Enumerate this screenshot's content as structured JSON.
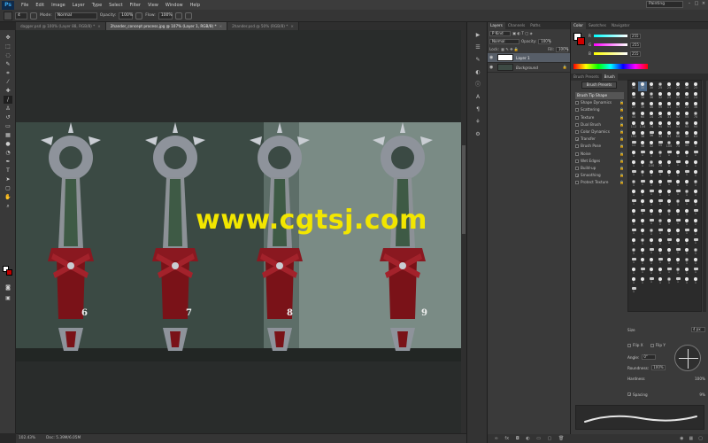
{
  "app": {
    "logo": "Ps",
    "menu": [
      "File",
      "Edit",
      "Image",
      "Layer",
      "Type",
      "Select",
      "Filter",
      "View",
      "Window",
      "Help"
    ],
    "workspace": "Painting",
    "min": "–",
    "max": "□",
    "close": "×"
  },
  "options": {
    "mode_label": "Mode:",
    "mode_value": "Normal",
    "opacity_label": "Opacity:",
    "opacity_value": "100%",
    "flow_label": "Flow:",
    "flow_value": "100%",
    "size_value": "4"
  },
  "tabs": [
    {
      "label": "dagger.psd @ 100% (Layer 88, RGB/8) *"
    },
    {
      "label": "2hander_concept process.jpg @ 107% (Layer 1, RGB/8) *"
    },
    {
      "label": "2hander.psd @ 50% (RGB/8) *"
    }
  ],
  "canvas": {
    "numbers": [
      "6",
      "7",
      "8",
      "9"
    ],
    "watermark": "www.cgtsj.com"
  },
  "status": {
    "zoom": "102.43%",
    "doc": "Doc: 5.39M/6.05M"
  },
  "layers_panel": {
    "tabs": [
      "Layers",
      "Channels",
      "Paths"
    ],
    "kind_label": "P Kind",
    "blend": "Normal",
    "opacity_label": "Opacity:",
    "opacity": "100%",
    "lock_label": "Lock:",
    "fill_label": "Fill:",
    "fill": "100%",
    "layers": [
      {
        "name": "Layer 1",
        "selected": true
      },
      {
        "name": "Background",
        "selected": false
      }
    ]
  },
  "color_panel": {
    "tabs": [
      "Color",
      "Swatches",
      "Navigator"
    ],
    "r_label": "R",
    "g_label": "G",
    "b_label": "B",
    "r": "255",
    "g": "255",
    "b": "255",
    "fg": "#ffffff",
    "bg": "#d00000"
  },
  "brush_panel": {
    "tabs": [
      "Brush Presets",
      "Brush"
    ],
    "presets_btn": "Brush Presets",
    "options": [
      {
        "label": "Brush Tip Shape",
        "head": true,
        "checked": false
      },
      {
        "label": "Shape Dynamics",
        "checked": false
      },
      {
        "label": "Scattering",
        "checked": false
      },
      {
        "label": "Texture",
        "checked": false
      },
      {
        "label": "Dual Brush",
        "checked": false
      },
      {
        "label": "Color Dynamics",
        "checked": false
      },
      {
        "label": "Transfer",
        "checked": true
      },
      {
        "label": "Brush Pose",
        "checked": false
      },
      {
        "label": "Noise",
        "checked": false
      },
      {
        "label": "Wet Edges",
        "checked": false
      },
      {
        "label": "Build-up",
        "checked": false
      },
      {
        "label": "Smoothing",
        "checked": true
      },
      {
        "label": "Protect Texture",
        "checked": false
      }
    ],
    "tip_numbers": [
      "30",
      "30",
      "30",
      "25",
      "25",
      "25",
      "36",
      "25",
      "36",
      "36",
      "36",
      "32",
      "25",
      "25",
      "14",
      "24",
      "27",
      "39",
      "46",
      "59",
      "11",
      "17",
      "23",
      "36",
      "44",
      "60",
      "14",
      "26",
      "33",
      "42",
      "55",
      "70",
      "112",
      "134",
      "74",
      "95",
      "95",
      "95",
      "95",
      "95",
      "192",
      "36",
      "36",
      "33",
      "63",
      "66",
      "39",
      "63",
      "11",
      "48",
      "32",
      "55",
      "100",
      "75",
      "45",
      "1",
      "1",
      "1",
      "1",
      "1",
      "1",
      "1",
      "1",
      "1",
      "1",
      "1",
      "100",
      "75",
      "1",
      "1",
      "1",
      "1",
      "1",
      "1",
      "1",
      "1",
      "1",
      "1",
      "1",
      "1",
      "1",
      "1",
      "1",
      "1",
      "1",
      "1",
      "1",
      "1",
      "1",
      "1",
      "1",
      "1",
      "1",
      "1",
      "1",
      "1",
      "1",
      "1",
      "1",
      "1",
      "1",
      "1",
      "1",
      "1",
      "1",
      "1",
      "1",
      "1",
      "1",
      "1",
      "1",
      "1",
      "1",
      "1",
      "1",
      "1",
      "1",
      "1",
      "1",
      "1",
      "1",
      "1",
      "1",
      "1",
      "1",
      "1",
      "1",
      "1",
      "1",
      "1",
      "1",
      "1",
      "1",
      "1",
      "1",
      "1",
      "1",
      "1",
      "1",
      "1",
      "1",
      "1",
      "1",
      "1",
      "1",
      "1",
      "1",
      "1",
      "1",
      "1",
      "1",
      "1",
      "1",
      "1",
      "1",
      "1",
      "1",
      "1",
      "1",
      "1",
      "1",
      "1",
      "1",
      "1",
      "1",
      "1",
      "1",
      "1",
      "1"
    ],
    "size_label": "Size",
    "size_value": "4 px",
    "flip_x": "Flip X",
    "flip_y": "Flip Y",
    "angle_label": "Angle:",
    "angle_value": "0°",
    "roundness_label": "Roundness:",
    "roundness_value": "100%",
    "hardness_label": "Hardness",
    "hardness_value": "100%",
    "spacing_label": "Spacing",
    "spacing_value": "9%"
  }
}
